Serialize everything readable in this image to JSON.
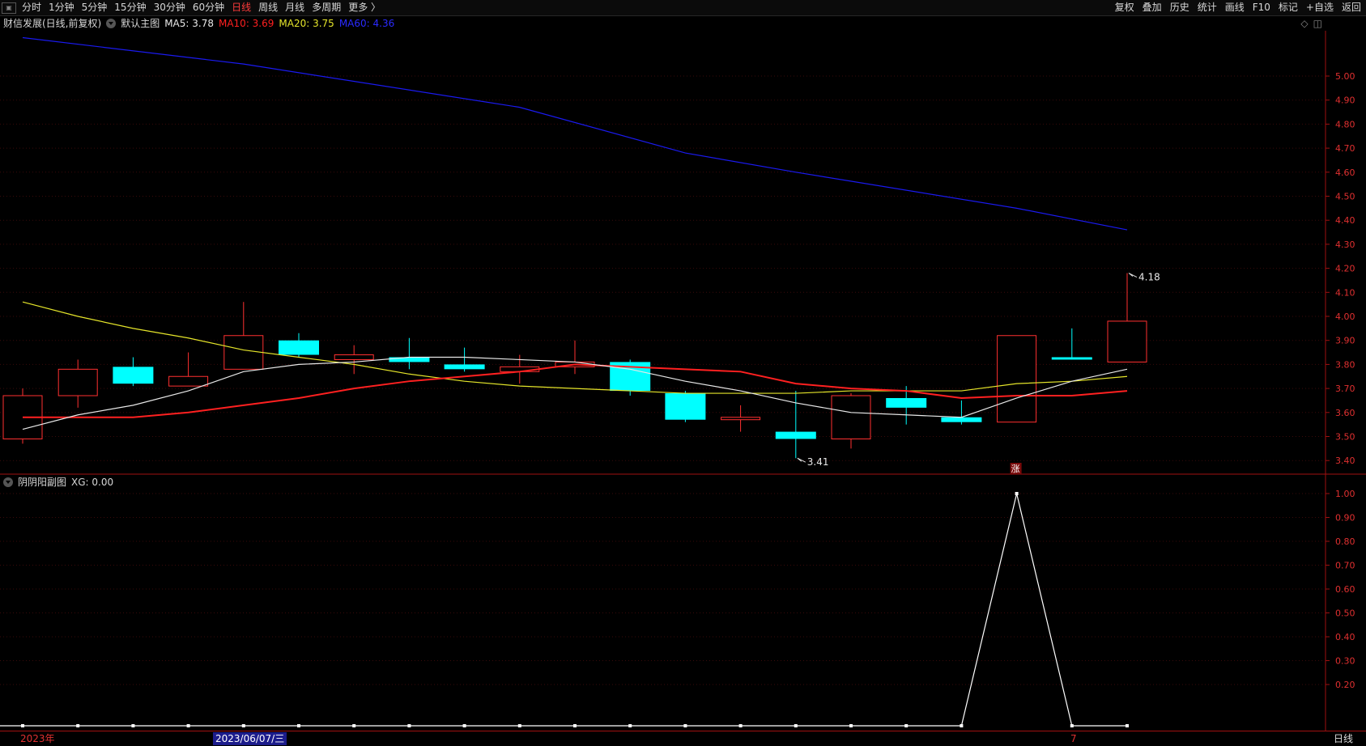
{
  "toolbar": {
    "periods": [
      "分时",
      "1分钟",
      "5分钟",
      "15分钟",
      "30分钟",
      "60分钟",
      "日线",
      "周线",
      "月线",
      "多周期",
      "更多 〉"
    ],
    "active_period": "日线",
    "right_buttons": [
      "复权",
      "叠加",
      "历史",
      "统计",
      "画线",
      "F10",
      "标记",
      "+自选",
      "返回"
    ]
  },
  "main_header": {
    "title": "财信发展(日线,前复权)",
    "indicator": "默认主图",
    "ma5": "MA5: 3.78",
    "ma10": "MA10: 3.69",
    "ma20": "MA20: 3.75",
    "ma60": "MA60: 4.36"
  },
  "sub_header": {
    "title": "阴阴阳副图",
    "xg": "XG: 0.00"
  },
  "bottom_bar": {
    "year_label": "2023年",
    "cursor_date": "2023/06/07/三",
    "month_label": "7",
    "period_label": "日线"
  },
  "colors": {
    "up": "#ff3030",
    "down": "#00ffff",
    "ma5": "#e8e8e8",
    "ma10": "#ff2020",
    "ma20": "#e5e52a",
    "ma60": "#1a1af0",
    "axis": "#a01010",
    "xg": "#ffffff"
  },
  "chart_data": [
    {
      "type": "candlestick",
      "ylim": [
        3.35,
        5.1
      ],
      "yticks": [
        "5.00",
        "4.90",
        "4.80",
        "4.70",
        "4.60",
        "4.50",
        "4.40",
        "4.30",
        "4.20",
        "4.10",
        "4.00",
        "3.90",
        "3.80",
        "3.70",
        "3.60",
        "3.50",
        "3.40"
      ],
      "candles": [
        {
          "open": 3.49,
          "high": 3.7,
          "low": 3.47,
          "close": 3.67
        },
        {
          "open": 3.67,
          "high": 3.82,
          "low": 3.62,
          "close": 3.78
        },
        {
          "open": 3.79,
          "high": 3.83,
          "low": 3.71,
          "close": 3.72
        },
        {
          "open": 3.71,
          "high": 3.85,
          "low": 3.71,
          "close": 3.75
        },
        {
          "open": 3.78,
          "high": 4.06,
          "low": 3.78,
          "close": 3.92
        },
        {
          "open": 3.9,
          "high": 3.93,
          "low": 3.83,
          "close": 3.84
        },
        {
          "open": 3.82,
          "high": 3.88,
          "low": 3.76,
          "close": 3.84
        },
        {
          "open": 3.83,
          "high": 3.91,
          "low": 3.78,
          "close": 3.81
        },
        {
          "open": 3.8,
          "high": 3.87,
          "low": 3.77,
          "close": 3.78
        },
        {
          "open": 3.77,
          "high": 3.84,
          "low": 3.72,
          "close": 3.79
        },
        {
          "open": 3.79,
          "high": 3.9,
          "low": 3.76,
          "close": 3.81
        },
        {
          "open": 3.81,
          "high": 3.82,
          "low": 3.67,
          "close": 3.69
        },
        {
          "open": 3.68,
          "high": 3.69,
          "low": 3.56,
          "close": 3.57
        },
        {
          "open": 3.57,
          "high": 3.63,
          "low": 3.52,
          "close": 3.58
        },
        {
          "open": 3.52,
          "high": 3.69,
          "low": 3.41,
          "close": 3.49
        },
        {
          "open": 3.49,
          "high": 3.68,
          "low": 3.45,
          "close": 3.67
        },
        {
          "open": 3.66,
          "high": 3.71,
          "low": 3.55,
          "close": 3.62
        },
        {
          "open": 3.58,
          "high": 3.65,
          "low": 3.55,
          "close": 3.56
        },
        {
          "open": 3.56,
          "high": 3.92,
          "low": 3.56,
          "close": 3.92
        },
        {
          "open": 3.83,
          "high": 3.95,
          "low": 3.82,
          "close": 3.82
        },
        {
          "open": 3.81,
          "high": 4.18,
          "low": 3.81,
          "close": 3.98
        }
      ],
      "ma5": [
        3.53,
        3.59,
        3.63,
        3.69,
        3.77,
        3.8,
        3.81,
        3.83,
        3.83,
        3.82,
        3.81,
        3.78,
        3.73,
        3.69,
        3.64,
        3.6,
        3.59,
        3.58,
        3.66,
        3.73,
        3.78
      ],
      "ma10": [
        3.58,
        3.58,
        3.58,
        3.6,
        3.63,
        3.66,
        3.7,
        3.73,
        3.75,
        3.77,
        3.8,
        3.79,
        3.78,
        3.77,
        3.72,
        3.7,
        3.69,
        3.66,
        3.67,
        3.67,
        3.69
      ],
      "ma20": [
        4.06,
        4.0,
        3.95,
        3.91,
        3.86,
        3.83,
        3.8,
        3.76,
        3.73,
        3.71,
        3.7,
        3.69,
        3.68,
        3.68,
        3.68,
        3.69,
        3.69,
        3.69,
        3.72,
        3.73,
        3.75
      ],
      "ma60_points": [
        [
          0,
          5.16
        ],
        [
          4,
          5.05
        ],
        [
          9,
          4.87
        ],
        [
          12,
          4.68
        ],
        [
          14,
          4.6
        ],
        [
          18,
          4.45
        ],
        [
          20,
          4.36
        ]
      ],
      "annotations": [
        {
          "label": "4.18",
          "index": 20,
          "value": 4.18
        },
        {
          "label": "3.41",
          "index": 14,
          "value": 3.41
        }
      ],
      "marker_label": "涨"
    },
    {
      "type": "line",
      "ylim": [
        0.05,
        1.05
      ],
      "yticks": [
        "1.00",
        "0.90",
        "0.80",
        "0.70",
        "0.60",
        "0.50",
        "0.40",
        "0.30",
        "0.20"
      ],
      "values": [
        0,
        0,
        0,
        0,
        0,
        0,
        0,
        0,
        0,
        0,
        0,
        0,
        0,
        0,
        0,
        0,
        0,
        0,
        1,
        0,
        0
      ]
    }
  ]
}
